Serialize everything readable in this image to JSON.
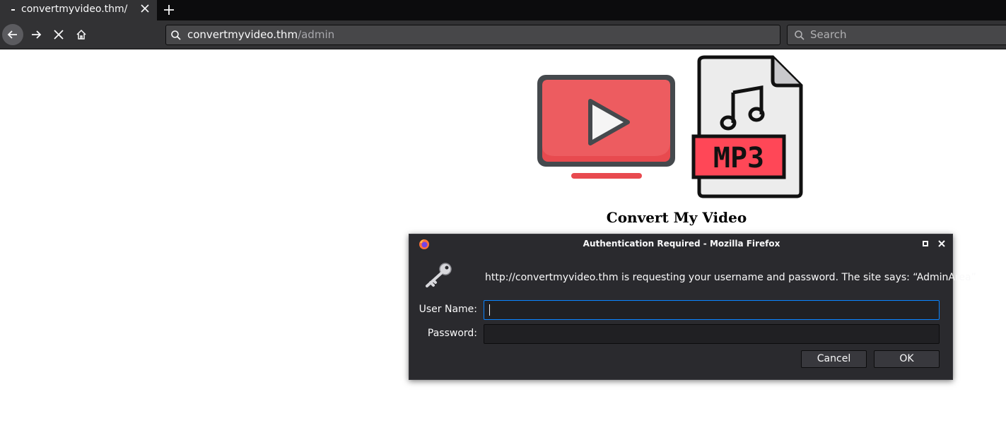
{
  "browser": {
    "tab": {
      "title": "convertmyvideo.thm/"
    },
    "url": {
      "host": "convertmyvideo.thm",
      "path": "/admin"
    },
    "search": {
      "placeholder": "Search"
    }
  },
  "page": {
    "logo_badge": "MP3",
    "heading": "Convert My Video"
  },
  "dialog": {
    "title": "Authentication Required - Mozilla Firefox",
    "message": "http://convertmyvideo.thm is requesting your username and password. The site says: “AdminArea”",
    "username_label": "User Name:",
    "password_label": "Password:",
    "username_value": "",
    "password_value": "",
    "cancel_label": "Cancel",
    "ok_label": "OK"
  },
  "colors": {
    "chrome_dark": "#0c0c0d",
    "toolbar": "#323234",
    "focus_blue": "#0a84ff",
    "tv_red": "#e84a4f",
    "mp3_red": "#ff4757"
  }
}
